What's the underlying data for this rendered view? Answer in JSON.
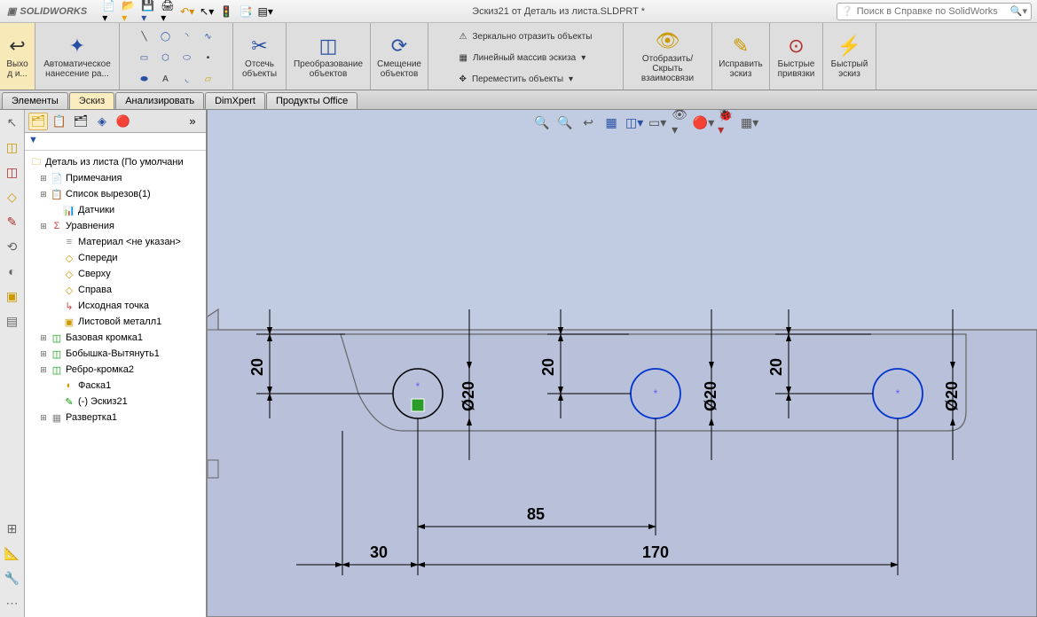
{
  "app": {
    "brand": "SOLIDWORKS",
    "doc_title": "Эскиз21 от Деталь из листа.SLDPRT *"
  },
  "search": {
    "placeholder": "Поиск в Справке по SolidWorks"
  },
  "qat_icons": [
    "new",
    "open",
    "save",
    "print",
    "undo",
    "arrow",
    "traffic",
    "settings",
    "grid"
  ],
  "ribbon": {
    "exit": "Выхо д и...",
    "autodim": "Автоматическое нанесение ра...",
    "tools_grid": [
      "line",
      "circle",
      "arc",
      "spline",
      "point",
      "rect",
      "poly",
      "ellipse",
      "slot",
      "text",
      "fillet",
      "chamfer"
    ],
    "trim": "Отсечь объекты",
    "transform": "Преобразование объектов",
    "offset": "Смещение объектов",
    "mirror": "Зеркально отразить объекты",
    "pattern": "Линейный массив эскиза",
    "move": "Переместить объекты",
    "display": "Отобразить/Скрыть взаимосвязи",
    "repair": "Исправить эскиз",
    "snap": "Быстрые привязки",
    "quick": "Быстрый эскиз"
  },
  "cmdtabs": [
    "Элементы",
    "Эскиз",
    "Анализировать",
    "DimXpert",
    "Продукты Office"
  ],
  "cmdtabs_active": 1,
  "tree": {
    "root": "Деталь из листа  (По умолчани",
    "items": [
      {
        "tw": "+",
        "ic": "📄",
        "label": "Примечания",
        "ind": 1,
        "col": "#c90"
      },
      {
        "tw": "+",
        "ic": "📋",
        "label": "Список вырезов(1)",
        "ind": 1,
        "col": "#090"
      },
      {
        "tw": "",
        "ic": "📊",
        "label": "Датчики",
        "ind": 2,
        "col": "#c44"
      },
      {
        "tw": "+",
        "ic": "Σ",
        "label": "Уравнения",
        "ind": 1,
        "col": "#c44"
      },
      {
        "tw": "",
        "ic": "≡",
        "label": "Материал <не указан>",
        "ind": 2,
        "col": "#888"
      },
      {
        "tw": "",
        "ic": "◇",
        "label": "Спереди",
        "ind": 2,
        "col": "#c90"
      },
      {
        "tw": "",
        "ic": "◇",
        "label": "Сверху",
        "ind": 2,
        "col": "#c90"
      },
      {
        "tw": "",
        "ic": "◇",
        "label": "Справа",
        "ind": 2,
        "col": "#c90"
      },
      {
        "tw": "",
        "ic": "↳",
        "label": "Исходная точка",
        "ind": 2,
        "col": "#c44"
      },
      {
        "tw": "",
        "ic": "▣",
        "label": "Листовой металл1",
        "ind": 2,
        "col": "#c90"
      },
      {
        "tw": "+",
        "ic": "◫",
        "label": "Базовая кромка1",
        "ind": 1,
        "col": "#090"
      },
      {
        "tw": "+",
        "ic": "◫",
        "label": "Бобышка-Вытянуть1",
        "ind": 1,
        "col": "#090"
      },
      {
        "tw": "+",
        "ic": "◫",
        "label": "Ребро-кромка2",
        "ind": 1,
        "col": "#090"
      },
      {
        "tw": "",
        "ic": "◐",
        "label": "Фаска1",
        "ind": 2,
        "col": "#c90"
      },
      {
        "tw": "",
        "ic": "✎",
        "label": "(-) Эскиз21",
        "ind": 2,
        "col": "#090"
      },
      {
        "tw": "+",
        "ic": "▦",
        "label": "Развертка1",
        "ind": 1,
        "col": "#888"
      }
    ]
  },
  "dims": {
    "v1": "20",
    "d1": "Ø20",
    "v2": "20",
    "d2": "Ø20",
    "v3": "20",
    "d3": "Ø20",
    "h30": "30",
    "h85": "85",
    "h170": "170"
  }
}
